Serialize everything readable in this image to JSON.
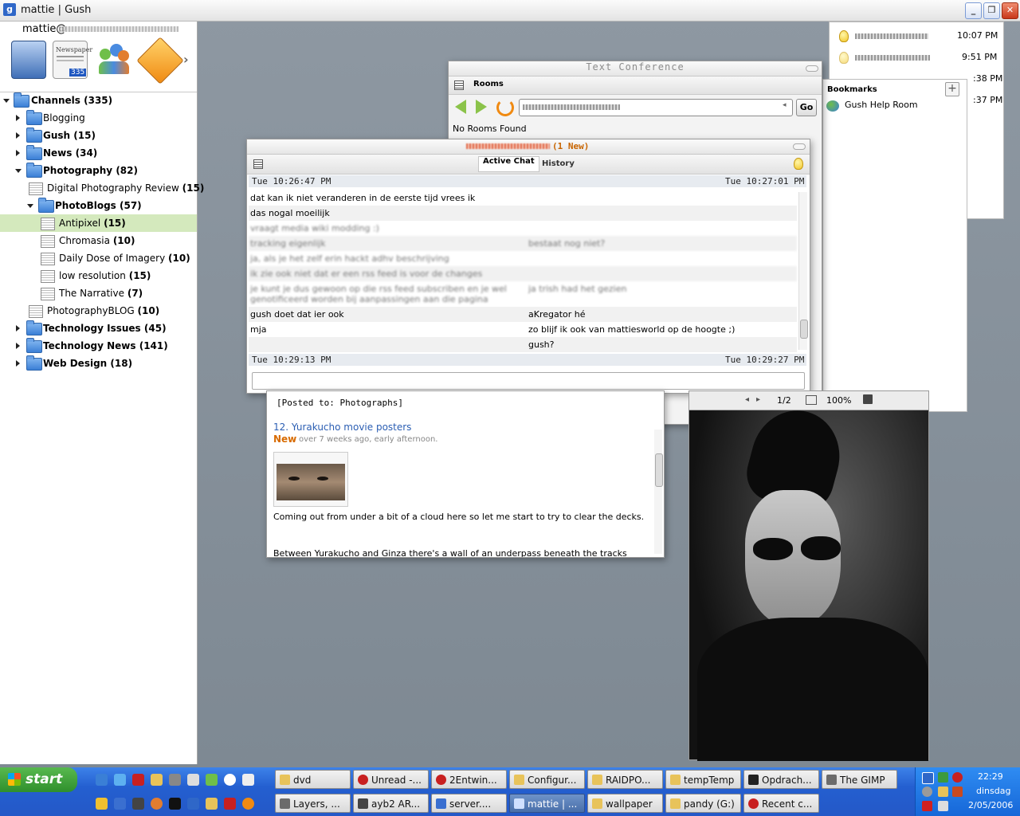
{
  "app": {
    "title": "mattie | Gush",
    "user": "mattie@"
  },
  "toolbar": {
    "newspaper_label": "Newspaper",
    "newspaper_count": "335"
  },
  "tree": [
    {
      "label": "Channels",
      "count": "(335)",
      "level": 0,
      "expanded": true,
      "bold": true
    },
    {
      "label": "Blogging",
      "count": "",
      "level": 1,
      "expanded": false,
      "bold": false
    },
    {
      "label": "Gush",
      "count": "(15)",
      "level": 1,
      "expanded": false,
      "bold": true
    },
    {
      "label": "News",
      "count": "(34)",
      "level": 1,
      "expanded": false,
      "bold": true
    },
    {
      "label": "Photography",
      "count": "(82)",
      "level": 1,
      "expanded": true,
      "bold": true
    },
    {
      "label": "Digital Photography Review",
      "count": "(15)",
      "level": 2,
      "feed": true
    },
    {
      "label": "PhotoBlogs",
      "count": "(57)",
      "level": 2,
      "expanded": true,
      "bold": true
    },
    {
      "label": "Antipixel",
      "count": "(15)",
      "level": 3,
      "feed": true,
      "selected": true
    },
    {
      "label": "Chromasia",
      "count": "(10)",
      "level": 3,
      "feed": true
    },
    {
      "label": "Daily Dose of Imagery",
      "count": "(10)",
      "level": 3,
      "feed": true
    },
    {
      "label": "low resolution",
      "count": "(15)",
      "level": 3,
      "feed": true
    },
    {
      "label": "The Narrative",
      "count": "(7)",
      "level": 3,
      "feed": true
    },
    {
      "label": "PhotographyBLOG",
      "count": "(10)",
      "level": 2,
      "feed": true
    },
    {
      "label": "Technology Issues",
      "count": "(45)",
      "level": 1,
      "expanded": false,
      "bold": true
    },
    {
      "label": "Technology News",
      "count": "(141)",
      "level": 1,
      "expanded": false,
      "bold": true
    },
    {
      "label": "Web Design",
      "count": "(18)",
      "level": 1,
      "expanded": false,
      "bold": true
    }
  ],
  "contacts": [
    {
      "time": "10:07 PM"
    },
    {
      "time": "9:51 PM"
    },
    {
      "time": ":38 PM"
    },
    {
      "time": ":37 PM"
    }
  ],
  "bookmarks": {
    "title": "Bookmarks",
    "items": [
      "Gush Help Room"
    ]
  },
  "conference": {
    "title": "Text Conference",
    "tab": "Rooms",
    "go_label": "Go",
    "status": "No Rooms Found"
  },
  "chat": {
    "title_suffix": "(1 New)",
    "tab_active": "Active Chat",
    "tab_history": "History",
    "start_left": "Tue 10:26:47 PM",
    "start_right": "Tue 10:27:01 PM",
    "end_left": "Tue 10:29:13 PM",
    "end_right": "Tue 10:29:27 PM",
    "rows": [
      {
        "left": "dat kan ik niet veranderen in de eerste tijd vrees ik",
        "right": "",
        "blur": false
      },
      {
        "left": "das nogal moeilijk",
        "right": "",
        "blur": false
      },
      {
        "left": "vraagt media wiki modding :)",
        "right": "",
        "blur": true
      },
      {
        "left": "tracking eigenlijk",
        "right": "bestaat nog niet?",
        "blur": true
      },
      {
        "left": "ja, als je het zelf erin hackt adhv beschrijving",
        "right": "",
        "blur": true
      },
      {
        "left": "ik zie ook niet dat er een rss feed is voor de changes",
        "right": "",
        "blur": true
      },
      {
        "left": "je kunt je dus gewoon op die rss feed subscriben en je wel genotificeerd worden bij aanpassingen aan die pagina",
        "right": "ja trish had het gezien",
        "blur": true
      },
      {
        "left": "gush doet dat ier ook",
        "right": "aKregator hé",
        "blur": false
      },
      {
        "left": "mja",
        "right": "zo blijf ik ook van mattiesworld op de hoogte ;)",
        "blur": false
      },
      {
        "left": "",
        "right": "gush?",
        "blur": false
      }
    ]
  },
  "blog": {
    "posted_to": "[Posted to: Photographs]",
    "item_title": "12. Yurakucho movie posters",
    "new_label": "New",
    "meta": "over 7 weeks ago, early afternoon.",
    "body1": "Coming out from under a bit of a cloud here so let me start to try to clear the decks.",
    "body2": "Between Yurakucho and Ginza there's a wall of an underpass beneath the tracks"
  },
  "viewer": {
    "page": "1/2",
    "zoom": "100%"
  },
  "taskbar": {
    "start_label": "start",
    "row1": [
      {
        "label": "dvd",
        "color": "#e8c35a"
      },
      {
        "label": "Unread -...",
        "color": "#c82020"
      },
      {
        "label": "2Entwin...",
        "color": "#c82020"
      },
      {
        "label": "Configur...",
        "color": "#e8c35a"
      },
      {
        "label": "RAIDPO...",
        "color": "#e8c35a"
      },
      {
        "label": "tempTemp",
        "color": "#e8c35a"
      },
      {
        "label": "Opdrach...",
        "color": "#222222"
      },
      {
        "label": "The GIMP",
        "color": "#6b6b6b"
      }
    ],
    "row2": [
      {
        "label": "Layers, ...",
        "color": "#6b6b6b",
        "active": false
      },
      {
        "label": "ayb2 AR...",
        "color": "#444444",
        "active": false
      },
      {
        "label": "server....",
        "color": "#3a6fd0",
        "active": false
      },
      {
        "label": "mattie | ...",
        "color": "#2f67c8",
        "active": true
      },
      {
        "label": "wallpaper",
        "color": "#e8c35a",
        "active": false
      },
      {
        "label": "pandy (G:)",
        "color": "#e8c35a",
        "active": false
      },
      {
        "label": "Recent c...",
        "color": "#c82020",
        "active": false
      }
    ],
    "clock_time": "22:29",
    "clock_day": "dinsdag",
    "clock_date": "2/05/2006"
  }
}
